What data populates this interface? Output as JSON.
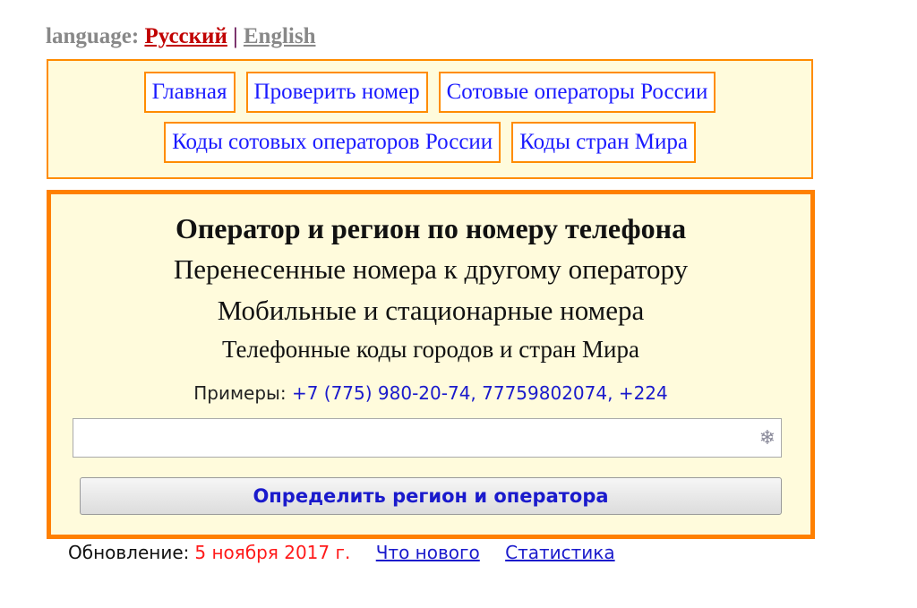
{
  "language": {
    "label": "language:",
    "russian": "Русский",
    "separator": "|",
    "english": "English"
  },
  "menu": {
    "row1": [
      "Главная",
      "Проверить номер",
      "Сотовые операторы России"
    ],
    "row2": [
      "Коды сотовых операторов России",
      "Коды стран Мира"
    ]
  },
  "main": {
    "title": "Оператор и регион по номеру телефона",
    "line2": "Перенесенные номера к другому оператору",
    "line3": "Мобильные и стационарные номера",
    "line4": "Телефонные коды городов и стран Мира",
    "examples_label": "Примеры:",
    "examples_values": "+7 (775) 980-20-74, 77759802074, +224",
    "input_value": "",
    "input_icon": "snowflake-icon",
    "snow_glyph": "❄",
    "submit_label": "Определить регион и оператора"
  },
  "footer": {
    "update_label": "Обновление:",
    "update_date": "5 ноября 2017 г.",
    "whats_new": "Что нового",
    "statistics": "Статистика"
  },
  "colors": {
    "accent_border": "#ff8000",
    "panel_bg": "#fffbdc",
    "link": "#1a1aff",
    "date": "#ff1a1a"
  }
}
